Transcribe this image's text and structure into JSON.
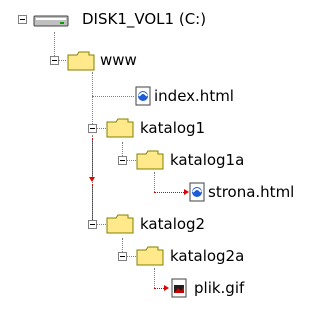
{
  "tree": {
    "root": {
      "label": "DISK1_VOL1 (C:)",
      "icon": "drive-icon"
    },
    "nodes": [
      {
        "label": "www",
        "icon": "folder-icon"
      },
      {
        "label": "index.html",
        "icon": "html-file-icon"
      },
      {
        "label": "katalog1",
        "icon": "folder-icon"
      },
      {
        "label": "katalog1a",
        "icon": "folder-icon"
      },
      {
        "label": "strona.html",
        "icon": "html-file-icon"
      },
      {
        "label": "katalog2",
        "icon": "folder-icon"
      },
      {
        "label": "katalog2a",
        "icon": "folder-icon"
      },
      {
        "label": "plik.gif",
        "icon": "image-file-icon"
      }
    ]
  },
  "colors": {
    "tree_lines": "#808080",
    "path_highlight": "#e00000",
    "folder": "#ffe98a"
  }
}
